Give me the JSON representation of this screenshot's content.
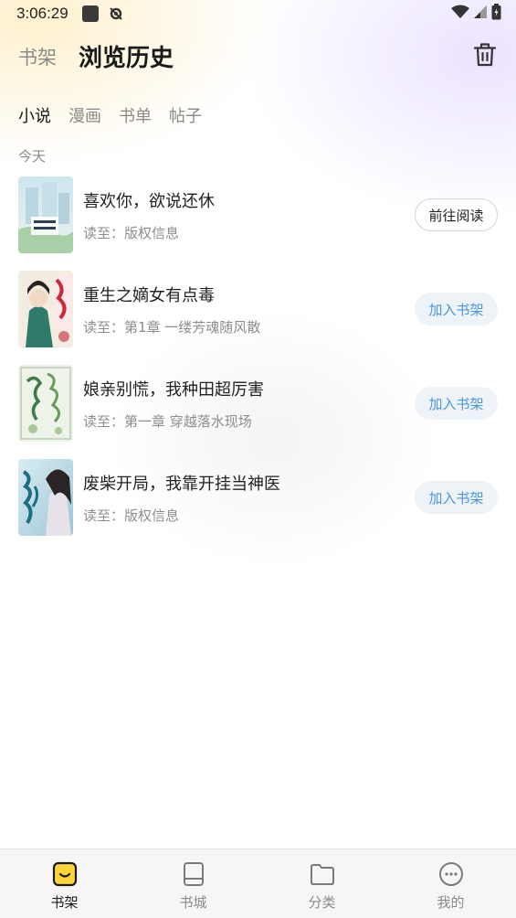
{
  "status_bar": {
    "time": "3:06:29"
  },
  "header": {
    "shelf_tab": "书架",
    "title": "浏览历史"
  },
  "category_tabs": [
    {
      "label": "小说",
      "active": true
    },
    {
      "label": "漫画",
      "active": false
    },
    {
      "label": "书单",
      "active": false
    },
    {
      "label": "帖子",
      "active": false
    }
  ],
  "section_label": "今天",
  "books": [
    {
      "title": "喜欢你，欲说还休",
      "progress": "读至：版权信息",
      "action": "前往阅读",
      "action_type": "read"
    },
    {
      "title": "重生之嫡女有点毒",
      "progress": "读至：第1章 一缕芳魂随风散",
      "action": "加入书架",
      "action_type": "add"
    },
    {
      "title": "娘亲别慌，我种田超厉害",
      "progress": "读至：第一章 穿越落水现场",
      "action": "加入书架",
      "action_type": "add"
    },
    {
      "title": "废柴开局，我靠开挂当神医",
      "progress": "读至：版权信息",
      "action": "加入书架",
      "action_type": "add"
    }
  ],
  "bottom_nav": [
    {
      "label": "书架",
      "icon": "bookshelf-icon",
      "active": true
    },
    {
      "label": "书城",
      "icon": "book-icon",
      "active": false
    },
    {
      "label": "分类",
      "icon": "folder-icon",
      "active": false
    },
    {
      "label": "我的",
      "icon": "profile-icon",
      "active": false
    }
  ],
  "colors": {
    "accent_yellow": "#FFD43A",
    "add_button_text": "#4A97D9",
    "add_button_bg": "#EEF3F8"
  }
}
